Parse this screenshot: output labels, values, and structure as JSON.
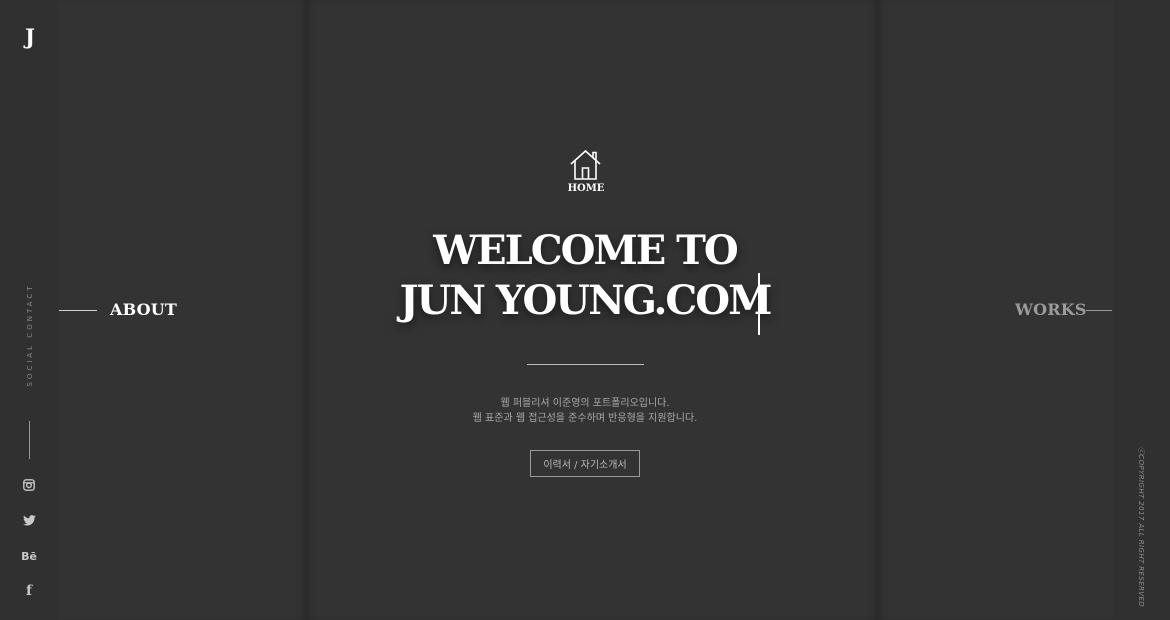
{
  "brand": {
    "logo_letter": "J"
  },
  "sidebar": {
    "social_label": "SOCIAL CONTACT",
    "social_links": [
      {
        "name": "instagram",
        "icon": "instagram-icon"
      },
      {
        "name": "twitter",
        "icon": "twitter-icon"
      },
      {
        "name": "behance",
        "icon": "behance-icon",
        "glyph": "Bē"
      },
      {
        "name": "facebook",
        "icon": "facebook-icon",
        "glyph": "f"
      }
    ]
  },
  "nav": {
    "about_label": "ABOUT",
    "works_label": "WORKS"
  },
  "hero": {
    "home_icon": "house-icon",
    "home_label": "HOME",
    "title_line1": "WELCOME TO",
    "title_line2": "JUN YOUNG.COM",
    "desc_line1": "웹 퍼블리셔 이준영의 포트폴리오입니다.",
    "desc_line2": "웹 표준과 웹 접근성을 준수하며 반응형을 지원합니다.",
    "button_label": "이력서 / 자기소개서"
  },
  "footer": {
    "copyright": "ⓒCOPYRIGHT 2017 ALL RIGHT RESERVED"
  },
  "colors": {
    "background": "#333333",
    "rail": "#303030",
    "text_primary": "#ffffff",
    "text_muted": "#9b9b9b"
  }
}
